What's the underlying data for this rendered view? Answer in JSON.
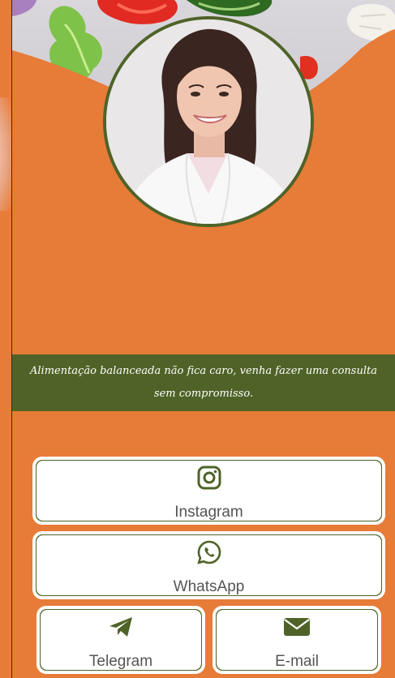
{
  "banner": {
    "text": "Alimentação balanceada não fica caro, venha fazer uma consulta sem compromisso."
  },
  "links": {
    "instagram": {
      "label": "Instagram",
      "icon": "instagram-icon"
    },
    "whatsapp": {
      "label": "WhatsApp",
      "icon": "whatsapp-icon"
    },
    "telegram": {
      "label": "Telegram",
      "icon": "telegram-icon"
    },
    "email": {
      "label": "E-mail",
      "icon": "envelope-icon"
    }
  },
  "colors": {
    "background": "#e77b38",
    "accent_green": "#4f6328",
    "button_bg": "#ffffff",
    "button_text": "#555555"
  }
}
